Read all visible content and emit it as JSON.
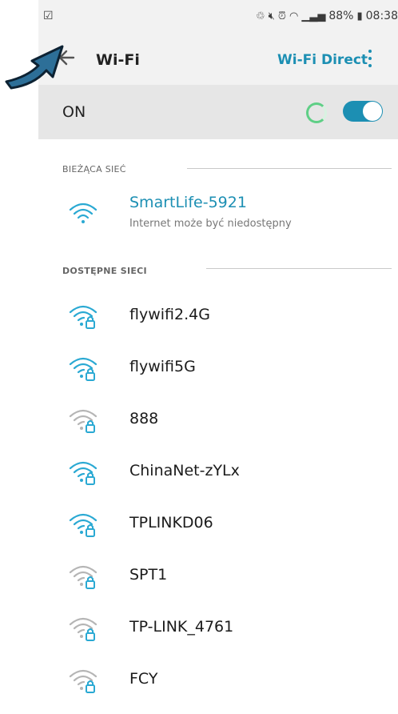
{
  "status_bar": {
    "left_icon": "☑",
    "battery": "88%",
    "time": "08:38"
  },
  "app_bar": {
    "title": "Wi-Fi",
    "wifi_direct": "Wi-Fi Direct"
  },
  "wifi_switch": {
    "label": "ON",
    "enabled": true
  },
  "current_network": {
    "section_label": "BIEŻĄCA SIEĆ",
    "name": "SmartLife-5921",
    "status": "Internet może być niedostępny"
  },
  "available": {
    "section_label": "DOSTĘPNE SIECI",
    "networks": [
      {
        "name": "flywifi2.4G",
        "locked": true,
        "strength": "strong"
      },
      {
        "name": "flywifi5G",
        "locked": true,
        "strength": "strong"
      },
      {
        "name": "888",
        "locked": true,
        "strength": "weak"
      },
      {
        "name": "ChinaNet-zYLx",
        "locked": true,
        "strength": "strong"
      },
      {
        "name": "TPLINKD06",
        "locked": true,
        "strength": "strong"
      },
      {
        "name": "SPT1",
        "locked": true,
        "strength": "weak"
      },
      {
        "name": "TP-LINK_4761",
        "locked": true,
        "strength": "weak"
      },
      {
        "name": "FCY",
        "locked": true,
        "strength": "weak"
      }
    ]
  },
  "colors": {
    "accent": "#1c8fb3",
    "strong_signal": "#2aa9d3",
    "weak_signal": "#b5b5b5",
    "arrow_fill": "#2d6f98"
  }
}
